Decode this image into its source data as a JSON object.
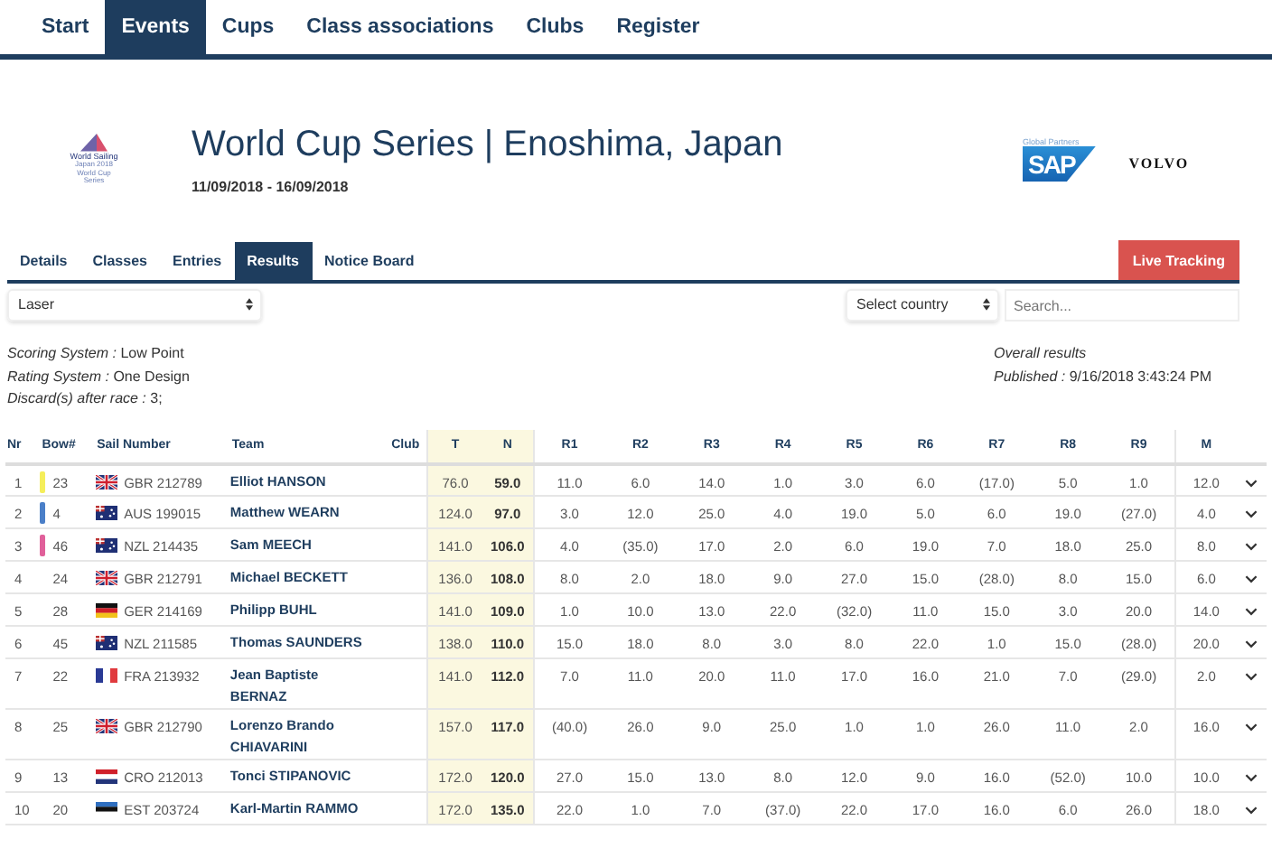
{
  "nav": [
    {
      "label": "Start",
      "selected": false
    },
    {
      "label": "Events",
      "selected": true
    },
    {
      "label": "Cups",
      "selected": false
    },
    {
      "label": "Class associations",
      "selected": false
    },
    {
      "label": "Clubs",
      "selected": false
    },
    {
      "label": "Register",
      "selected": false
    }
  ],
  "logo": {
    "name": "World Sailing",
    "lines": [
      "Japan 2018",
      "World Cup",
      "Series"
    ]
  },
  "event": {
    "title": "World Cup Series | Enoshima, Japan",
    "dates": "11/09/2018 - 16/09/2018"
  },
  "partners": {
    "caption": "Global Partners",
    "sap": "SAP",
    "volvo": "VOLVO"
  },
  "subtabs": [
    {
      "label": "Details",
      "selected": false
    },
    {
      "label": "Classes",
      "selected": false
    },
    {
      "label": "Entries",
      "selected": false
    },
    {
      "label": "Results",
      "selected": true
    },
    {
      "label": "Notice Board",
      "selected": false
    }
  ],
  "live_button": "Live Tracking",
  "class_select": "Laser",
  "country_select": "Select country",
  "search": {
    "placeholder": "Search..."
  },
  "info": [
    {
      "label": "Scoring System :",
      "value": "Low Point"
    },
    {
      "label": "Rating System :",
      "value": "One Design"
    },
    {
      "label": "Discard(s) after race :",
      "value": "3;"
    }
  ],
  "overall": "Overall results",
  "published": {
    "label": "Published :",
    "value": "9/16/2018 3:43:24 PM"
  },
  "columns": [
    "Nr",
    "Bow#",
    "Sail Number",
    "Team",
    "Club",
    "T",
    "N",
    "R1",
    "R2",
    "R3",
    "R4",
    "R5",
    "R6",
    "R7",
    "R8",
    "R9",
    "M"
  ],
  "rows": [
    {
      "nr": "1",
      "color": "#f5ee5a",
      "bow": "23",
      "kind": "gb",
      "sail": "GBR 212789",
      "team": "Elliot HANSON",
      "t": "76.0",
      "n": "59.0",
      "races": [
        "11.0",
        "6.0",
        "14.0",
        "1.0",
        "3.0",
        "6.0",
        "(17.0)",
        "5.0",
        "1.0"
      ],
      "m": "12.0"
    },
    {
      "nr": "2",
      "color": "#4a7fc8",
      "bow": "4",
      "kind": "au",
      "sail": "AUS 199015",
      "team": "Matthew WEARN",
      "t": "124.0",
      "n": "97.0",
      "races": [
        "3.0",
        "12.0",
        "25.0",
        "4.0",
        "19.0",
        "5.0",
        "6.0",
        "19.0",
        "(27.0)"
      ],
      "m": "4.0"
    },
    {
      "nr": "3",
      "color": "#e0609a",
      "bow": "46",
      "kind": "nz",
      "sail": "NZL 214435",
      "team": "Sam MEECH",
      "t": "141.0",
      "n": "106.0",
      "races": [
        "4.0",
        "(35.0)",
        "17.0",
        "2.0",
        "6.0",
        "19.0",
        "7.0",
        "18.0",
        "25.0"
      ],
      "m": "8.0"
    },
    {
      "nr": "4",
      "bow": "24",
      "kind": "gb",
      "sail": "GBR 212791",
      "team": "Michael BECKETT",
      "t": "136.0",
      "n": "108.0",
      "races": [
        "8.0",
        "2.0",
        "18.0",
        "9.0",
        "27.0",
        "15.0",
        "(28.0)",
        "8.0",
        "15.0"
      ],
      "m": "6.0"
    },
    {
      "nr": "5",
      "bow": "28",
      "kind": "de",
      "sail": "GER 214169",
      "team": "Philipp BUHL",
      "t": "141.0",
      "n": "109.0",
      "races": [
        "1.0",
        "10.0",
        "13.0",
        "22.0",
        "(32.0)",
        "11.0",
        "15.0",
        "3.0",
        "20.0"
      ],
      "m": "14.0"
    },
    {
      "nr": "6",
      "bow": "45",
      "kind": "nz",
      "sail": "NZL 211585",
      "team": "Thomas SAUNDERS",
      "t": "138.0",
      "n": "110.0",
      "races": [
        "15.0",
        "18.0",
        "8.0",
        "3.0",
        "8.0",
        "22.0",
        "1.0",
        "15.0",
        "(28.0)"
      ],
      "m": "20.0"
    },
    {
      "nr": "7",
      "bow": "22",
      "kind": "fr",
      "sail": "FRA 213932",
      "team": "Jean Baptiste BERNAZ",
      "t": "141.0",
      "n": "112.0",
      "races": [
        "7.0",
        "11.0",
        "20.0",
        "11.0",
        "17.0",
        "16.0",
        "21.0",
        "7.0",
        "(29.0)"
      ],
      "m": "2.0"
    },
    {
      "nr": "8",
      "bow": "25",
      "kind": "gb",
      "sail": "GBR 212790",
      "team": "Lorenzo Brando CHIAVARINI",
      "t": "157.0",
      "n": "117.0",
      "races": [
        "(40.0)",
        "26.0",
        "9.0",
        "25.0",
        "1.0",
        "1.0",
        "26.0",
        "11.0",
        "2.0"
      ],
      "m": "16.0"
    },
    {
      "nr": "9",
      "bow": "13",
      "kind": "hr",
      "sail": "CRO 212013",
      "team": "Tonci STIPANOVIC",
      "t": "172.0",
      "n": "120.0",
      "races": [
        "27.0",
        "15.0",
        "13.0",
        "8.0",
        "12.0",
        "9.0",
        "16.0",
        "(52.0)",
        "10.0"
      ],
      "m": "10.0"
    },
    {
      "nr": "10",
      "bow": "20",
      "kind": "ee",
      "sail": "EST 203724",
      "team": "Karl-Martin RAMMO",
      "t": "172.0",
      "n": "135.0",
      "races": [
        "22.0",
        "1.0",
        "7.0",
        "(37.0)",
        "22.0",
        "17.0",
        "16.0",
        "6.0",
        "26.0"
      ],
      "m": "18.0"
    }
  ]
}
